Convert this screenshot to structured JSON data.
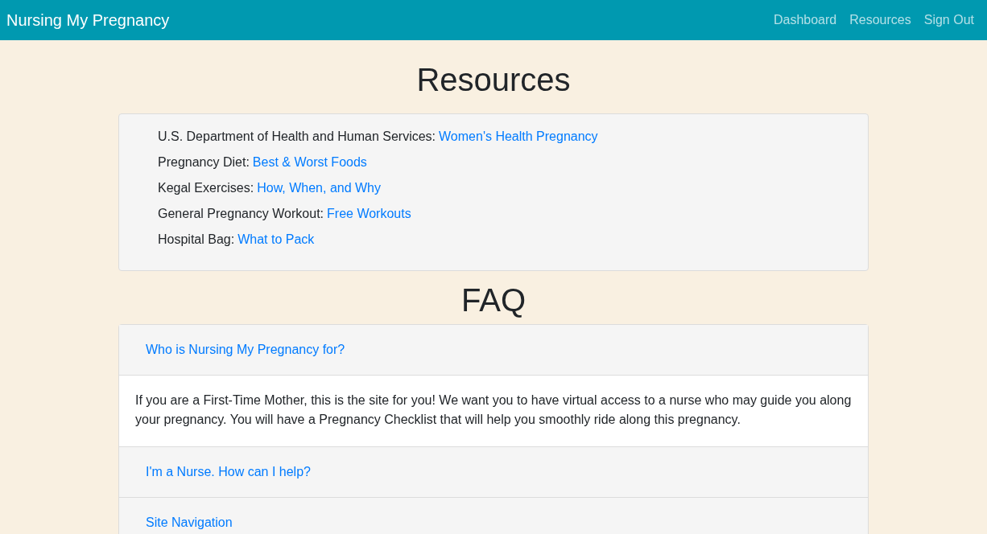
{
  "navbar": {
    "brand": "Nursing My Pregnancy",
    "links": [
      "Dashboard",
      "Resources",
      "Sign Out"
    ]
  },
  "resources": {
    "title": "Resources",
    "items": [
      {
        "label": "U.S. Department of Health and Human Services:",
        "link": "Women's Health Pregnancy"
      },
      {
        "label": "Pregnancy Diet:",
        "link": "Best & Worst Foods"
      },
      {
        "label": "Kegal Exercises:",
        "link": "How, When, and Why"
      },
      {
        "label": "General Pregnancy Workout:",
        "link": "Free Workouts"
      },
      {
        "label": "Hospital Bag:",
        "link": "What to Pack"
      }
    ]
  },
  "faq": {
    "title": "FAQ",
    "items": [
      {
        "question": "Who is Nursing My Pregnancy for?",
        "expanded": true,
        "answer": "If you are a First-Time Mother, this is the site for you! We want you to have virtual access to a nurse who may guide you along your pregnancy. You will have a Pregnancy Checklist that will help you smoothly ride along this pregnancy."
      },
      {
        "question": "I'm a Nurse. How can I help?",
        "expanded": false
      },
      {
        "question": "Site Navigation",
        "expanded": false
      }
    ]
  }
}
